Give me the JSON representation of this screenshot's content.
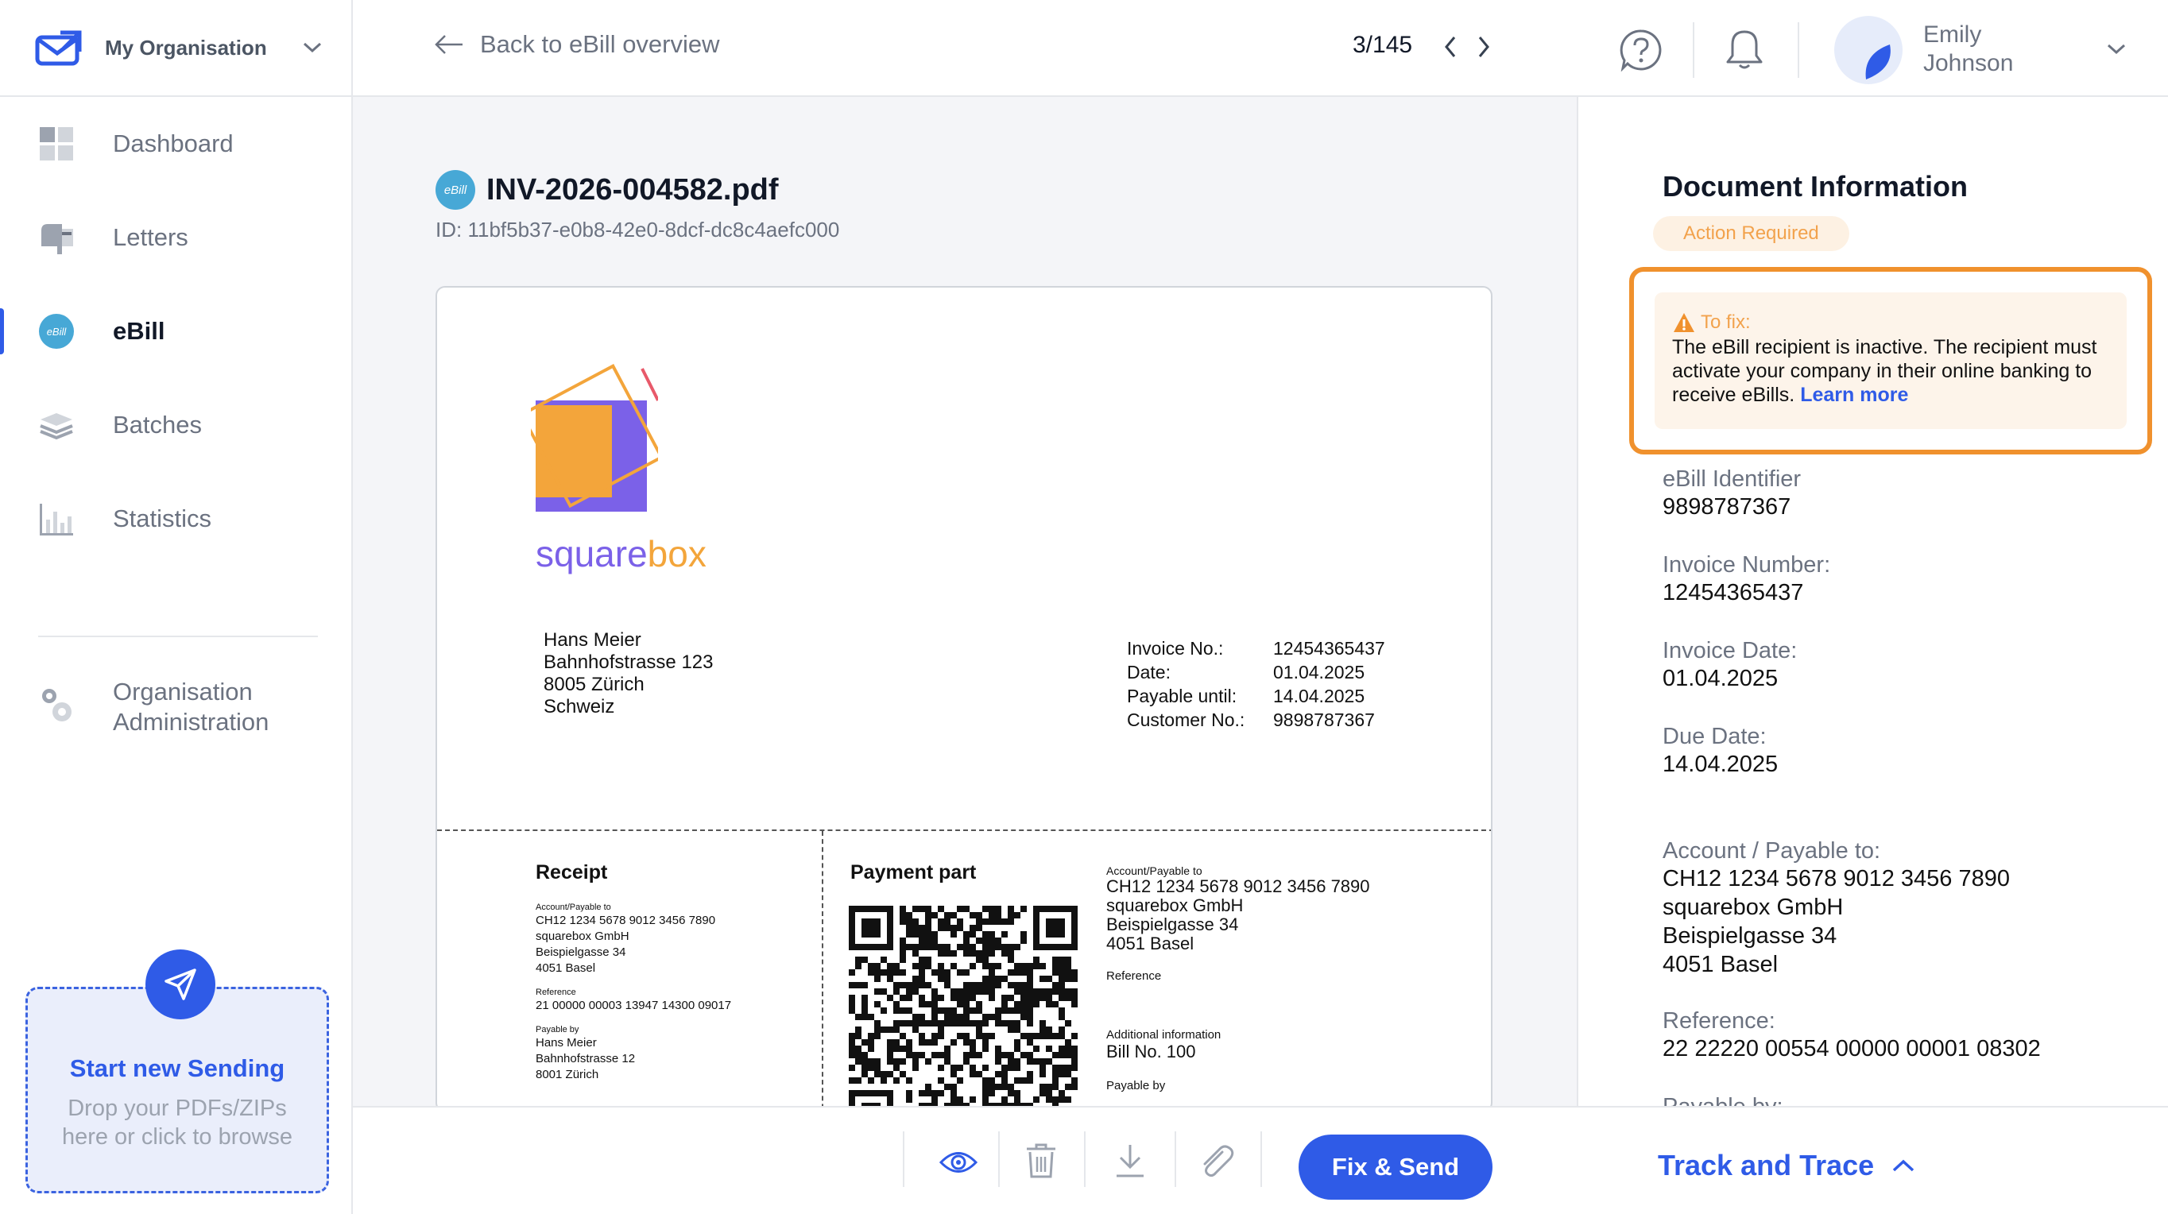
{
  "org": {
    "name": "My Organisation"
  },
  "sidebar": {
    "items": [
      {
        "label": "Dashboard",
        "icon": "dashboard-icon"
      },
      {
        "label": "Letters",
        "icon": "mailbox-icon"
      },
      {
        "label": "eBill",
        "icon": "ebill-icon",
        "active": true
      },
      {
        "label": "Batches",
        "icon": "layers-icon"
      },
      {
        "label": "Statistics",
        "icon": "bar-chart-icon"
      }
    ],
    "admin": {
      "line1": "Organisation",
      "line2": "Administration"
    },
    "dropzone": {
      "title": "Start new Sending",
      "line1": "Drop your PDFs/ZIPs",
      "line2": "here or click to browse"
    }
  },
  "topbar": {
    "back_label": "Back to eBill overview",
    "pager": "3/145",
    "user": {
      "first": "Emily",
      "last": "Johnson"
    }
  },
  "document": {
    "badge": "eBill",
    "filename": "INV-2026-004582.pdf",
    "id": "ID: 11bf5b37-e0b8-42e0-8dcf-dc8c4aefc000",
    "brand": {
      "pre": "square",
      "post": "box"
    },
    "address": [
      "Hans Meier",
      "Bahnhofstrasse 123",
      "8005 Zürich",
      "Schweiz"
    ],
    "meta": [
      {
        "k": "Invoice No.:",
        "v": "12454365437"
      },
      {
        "k": "Date:",
        "v": "01.04.2025"
      },
      {
        "k": "Payable until:",
        "v": "14.04.2025"
      },
      {
        "k": "Customer No.:",
        "v": "9898787367"
      }
    ],
    "receipt": {
      "title": "Receipt",
      "acct_label": "Account/Payable to",
      "acct_lines": [
        "CH12 1234 5678 9012 3456 7890",
        "squarebox GmbH",
        "Beispielgasse 34",
        "4051 Basel"
      ],
      "ref_label": "Reference",
      "ref": "21 00000 00003 13947 14300 09017",
      "payby_label": "Payable by",
      "payby_lines": [
        "Hans Meier",
        "Bahnhofstrasse 12",
        "8001 Zürich"
      ]
    },
    "payment": {
      "title": "Payment part",
      "acct_label": "Account/Payable to",
      "acct_lines": [
        "CH12 1234 5678 9012 3456 7890",
        "squarebox GmbH",
        "Beispielgasse 34",
        "4051 Basel"
      ],
      "ref_label": "Reference",
      "addinfo_label": "Additional information",
      "addinfo": "Bill No. 100",
      "payby_label": "Payable by"
    }
  },
  "panel": {
    "title": "Document Information",
    "status": "Action Required",
    "fix": {
      "head": "To fix:",
      "body": "The eBill recipient is inactive. The recipient must activate your company in their online banking to receive eBills.",
      "link": "Learn more"
    },
    "fields": [
      {
        "k": "eBill Identifier",
        "v": "9898787367"
      },
      {
        "k": "Invoice Number:",
        "v": "12454365437"
      },
      {
        "k": "Invoice Date:",
        "v": "01.04.2025"
      },
      {
        "k": "Due Date:",
        "v": "14.04.2025"
      }
    ],
    "account": {
      "k": "Account / Payable to:",
      "lines": [
        "CH12 1234 5678 9012 3456 7890",
        "squarebox GmbH",
        "Beispielgasse 34",
        "4051 Basel"
      ]
    },
    "reference": {
      "k": "Reference:",
      "v": "22 22220 00554 00000 00001 08302"
    },
    "payable_by": {
      "k": "Payable by:"
    }
  },
  "bottombar": {
    "actions": [
      "eye-icon",
      "trash-icon",
      "download-icon",
      "paperclip-icon"
    ],
    "fix_send": "Fix & Send",
    "track": "Track and Trace"
  },
  "colors": {
    "accent": "#2f5be7",
    "warning": "#f0912d",
    "warning_bg": "#fdf4ea",
    "ebill": "#47a8d6",
    "brand_purple": "#7b61e8",
    "brand_orange": "#f3a53b"
  }
}
